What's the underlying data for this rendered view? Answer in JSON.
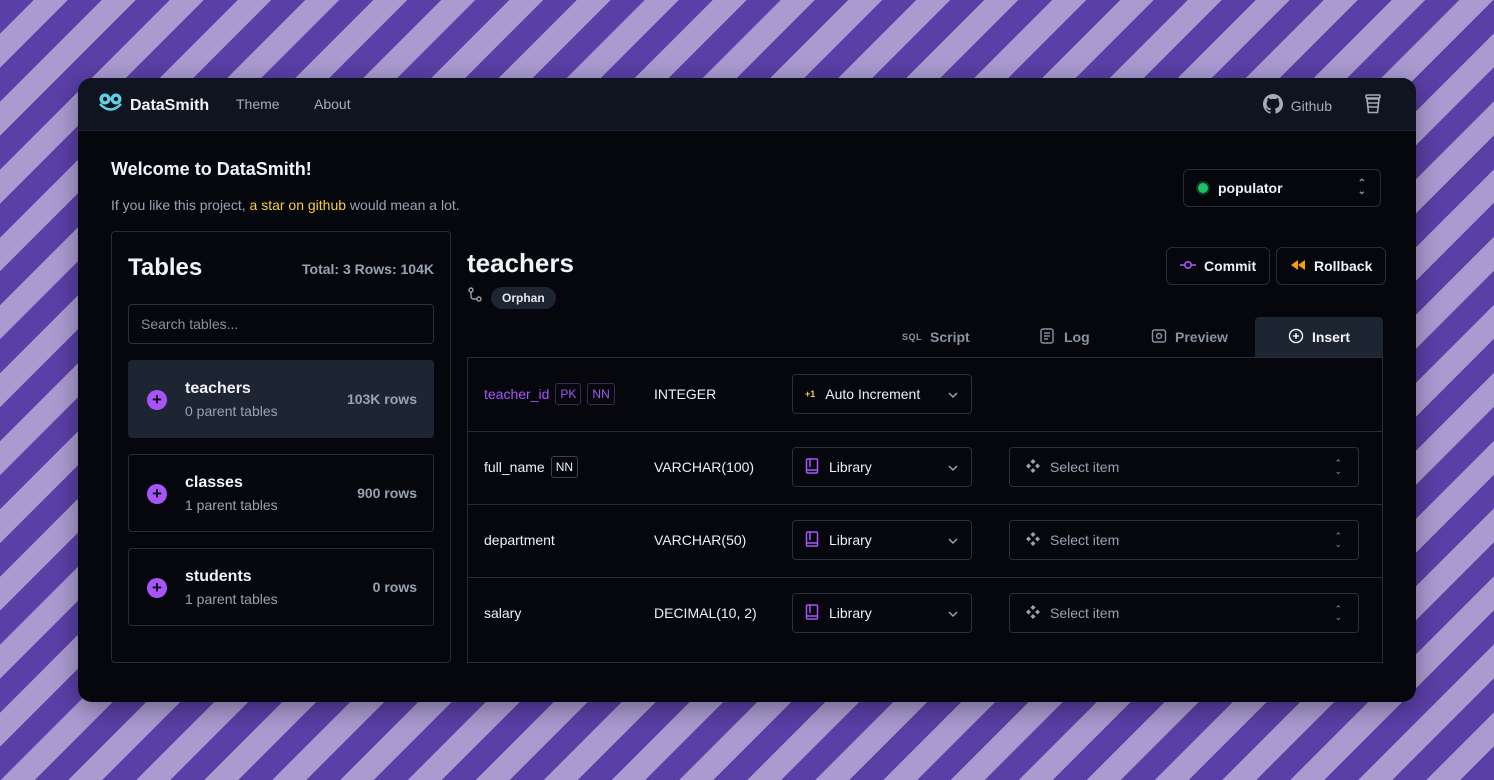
{
  "navbar": {
    "brand": "DataSmith",
    "links": [
      "Theme",
      "About"
    ],
    "github_label": "Github"
  },
  "welcome": {
    "title": "Welcome to DataSmith!",
    "text_before": "If you like this project, ",
    "link_text": "a star on github",
    "text_after": " would mean a lot."
  },
  "db_selector": {
    "value": "populator"
  },
  "tables_panel": {
    "title": "Tables",
    "summary": "Total: 3 Rows: 104K",
    "search_placeholder": "Search tables...",
    "items": [
      {
        "name": "teachers",
        "parents": "0 parent tables",
        "rows": "103K rows"
      },
      {
        "name": "classes",
        "parents": "1 parent tables",
        "rows": "900 rows"
      },
      {
        "name": "students",
        "parents": "1 parent tables",
        "rows": "0 rows"
      }
    ]
  },
  "table_view": {
    "title": "teachers",
    "badge": "Orphan",
    "commit_label": "Commit",
    "rollback_label": "Rollback",
    "tabs": [
      {
        "icon_text": "SQL",
        "label": "Script"
      },
      {
        "label": "Log"
      },
      {
        "label": "Preview"
      },
      {
        "label": "Insert"
      }
    ],
    "columns": [
      {
        "name": "teacher_id",
        "tags": [
          "PK",
          "NN"
        ],
        "type": "INTEGER",
        "generator": "Auto Increment",
        "generator_icon_text": "+1"
      },
      {
        "name": "full_name",
        "tags": [
          "NN"
        ],
        "type": "VARCHAR(100)",
        "generator": "Library",
        "item": "Select item"
      },
      {
        "name": "department",
        "tags": [],
        "type": "VARCHAR(50)",
        "generator": "Library",
        "item": "Select item"
      },
      {
        "name": "salary",
        "tags": [],
        "type": "DECIMAL(10, 2)",
        "generator": "Library",
        "item": "Select item"
      }
    ]
  },
  "colors": {
    "accent_purple": "#a855f7",
    "link_yellow": "#f5cf3a",
    "status_green": "#1fc06a",
    "rollback_orange": "#f59e0b"
  }
}
